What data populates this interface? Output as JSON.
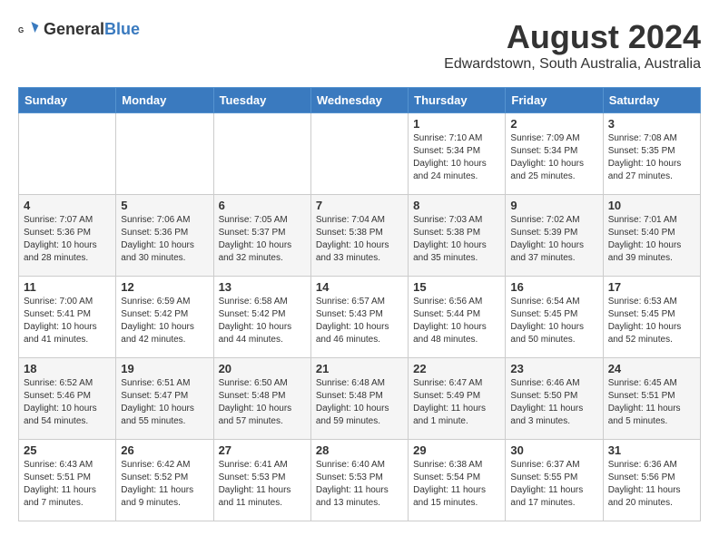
{
  "header": {
    "logo_general": "General",
    "logo_blue": "Blue",
    "month": "August 2024",
    "location": "Edwardstown, South Australia, Australia"
  },
  "weekdays": [
    "Sunday",
    "Monday",
    "Tuesday",
    "Wednesday",
    "Thursday",
    "Friday",
    "Saturday"
  ],
  "weeks": [
    [
      {
        "day": "",
        "info": ""
      },
      {
        "day": "",
        "info": ""
      },
      {
        "day": "",
        "info": ""
      },
      {
        "day": "",
        "info": ""
      },
      {
        "day": "1",
        "info": "Sunrise: 7:10 AM\nSunset: 5:34 PM\nDaylight: 10 hours\nand 24 minutes."
      },
      {
        "day": "2",
        "info": "Sunrise: 7:09 AM\nSunset: 5:34 PM\nDaylight: 10 hours\nand 25 minutes."
      },
      {
        "day": "3",
        "info": "Sunrise: 7:08 AM\nSunset: 5:35 PM\nDaylight: 10 hours\nand 27 minutes."
      }
    ],
    [
      {
        "day": "4",
        "info": "Sunrise: 7:07 AM\nSunset: 5:36 PM\nDaylight: 10 hours\nand 28 minutes."
      },
      {
        "day": "5",
        "info": "Sunrise: 7:06 AM\nSunset: 5:36 PM\nDaylight: 10 hours\nand 30 minutes."
      },
      {
        "day": "6",
        "info": "Sunrise: 7:05 AM\nSunset: 5:37 PM\nDaylight: 10 hours\nand 32 minutes."
      },
      {
        "day": "7",
        "info": "Sunrise: 7:04 AM\nSunset: 5:38 PM\nDaylight: 10 hours\nand 33 minutes."
      },
      {
        "day": "8",
        "info": "Sunrise: 7:03 AM\nSunset: 5:38 PM\nDaylight: 10 hours\nand 35 minutes."
      },
      {
        "day": "9",
        "info": "Sunrise: 7:02 AM\nSunset: 5:39 PM\nDaylight: 10 hours\nand 37 minutes."
      },
      {
        "day": "10",
        "info": "Sunrise: 7:01 AM\nSunset: 5:40 PM\nDaylight: 10 hours\nand 39 minutes."
      }
    ],
    [
      {
        "day": "11",
        "info": "Sunrise: 7:00 AM\nSunset: 5:41 PM\nDaylight: 10 hours\nand 41 minutes."
      },
      {
        "day": "12",
        "info": "Sunrise: 6:59 AM\nSunset: 5:42 PM\nDaylight: 10 hours\nand 42 minutes."
      },
      {
        "day": "13",
        "info": "Sunrise: 6:58 AM\nSunset: 5:42 PM\nDaylight: 10 hours\nand 44 minutes."
      },
      {
        "day": "14",
        "info": "Sunrise: 6:57 AM\nSunset: 5:43 PM\nDaylight: 10 hours\nand 46 minutes."
      },
      {
        "day": "15",
        "info": "Sunrise: 6:56 AM\nSunset: 5:44 PM\nDaylight: 10 hours\nand 48 minutes."
      },
      {
        "day": "16",
        "info": "Sunrise: 6:54 AM\nSunset: 5:45 PM\nDaylight: 10 hours\nand 50 minutes."
      },
      {
        "day": "17",
        "info": "Sunrise: 6:53 AM\nSunset: 5:45 PM\nDaylight: 10 hours\nand 52 minutes."
      }
    ],
    [
      {
        "day": "18",
        "info": "Sunrise: 6:52 AM\nSunset: 5:46 PM\nDaylight: 10 hours\nand 54 minutes."
      },
      {
        "day": "19",
        "info": "Sunrise: 6:51 AM\nSunset: 5:47 PM\nDaylight: 10 hours\nand 55 minutes."
      },
      {
        "day": "20",
        "info": "Sunrise: 6:50 AM\nSunset: 5:48 PM\nDaylight: 10 hours\nand 57 minutes."
      },
      {
        "day": "21",
        "info": "Sunrise: 6:48 AM\nSunset: 5:48 PM\nDaylight: 10 hours\nand 59 minutes."
      },
      {
        "day": "22",
        "info": "Sunrise: 6:47 AM\nSunset: 5:49 PM\nDaylight: 11 hours\nand 1 minute."
      },
      {
        "day": "23",
        "info": "Sunrise: 6:46 AM\nSunset: 5:50 PM\nDaylight: 11 hours\nand 3 minutes."
      },
      {
        "day": "24",
        "info": "Sunrise: 6:45 AM\nSunset: 5:51 PM\nDaylight: 11 hours\nand 5 minutes."
      }
    ],
    [
      {
        "day": "25",
        "info": "Sunrise: 6:43 AM\nSunset: 5:51 PM\nDaylight: 11 hours\nand 7 minutes."
      },
      {
        "day": "26",
        "info": "Sunrise: 6:42 AM\nSunset: 5:52 PM\nDaylight: 11 hours\nand 9 minutes."
      },
      {
        "day": "27",
        "info": "Sunrise: 6:41 AM\nSunset: 5:53 PM\nDaylight: 11 hours\nand 11 minutes."
      },
      {
        "day": "28",
        "info": "Sunrise: 6:40 AM\nSunset: 5:53 PM\nDaylight: 11 hours\nand 13 minutes."
      },
      {
        "day": "29",
        "info": "Sunrise: 6:38 AM\nSunset: 5:54 PM\nDaylight: 11 hours\nand 15 minutes."
      },
      {
        "day": "30",
        "info": "Sunrise: 6:37 AM\nSunset: 5:55 PM\nDaylight: 11 hours\nand 17 minutes."
      },
      {
        "day": "31",
        "info": "Sunrise: 6:36 AM\nSunset: 5:56 PM\nDaylight: 11 hours\nand 20 minutes."
      }
    ]
  ]
}
